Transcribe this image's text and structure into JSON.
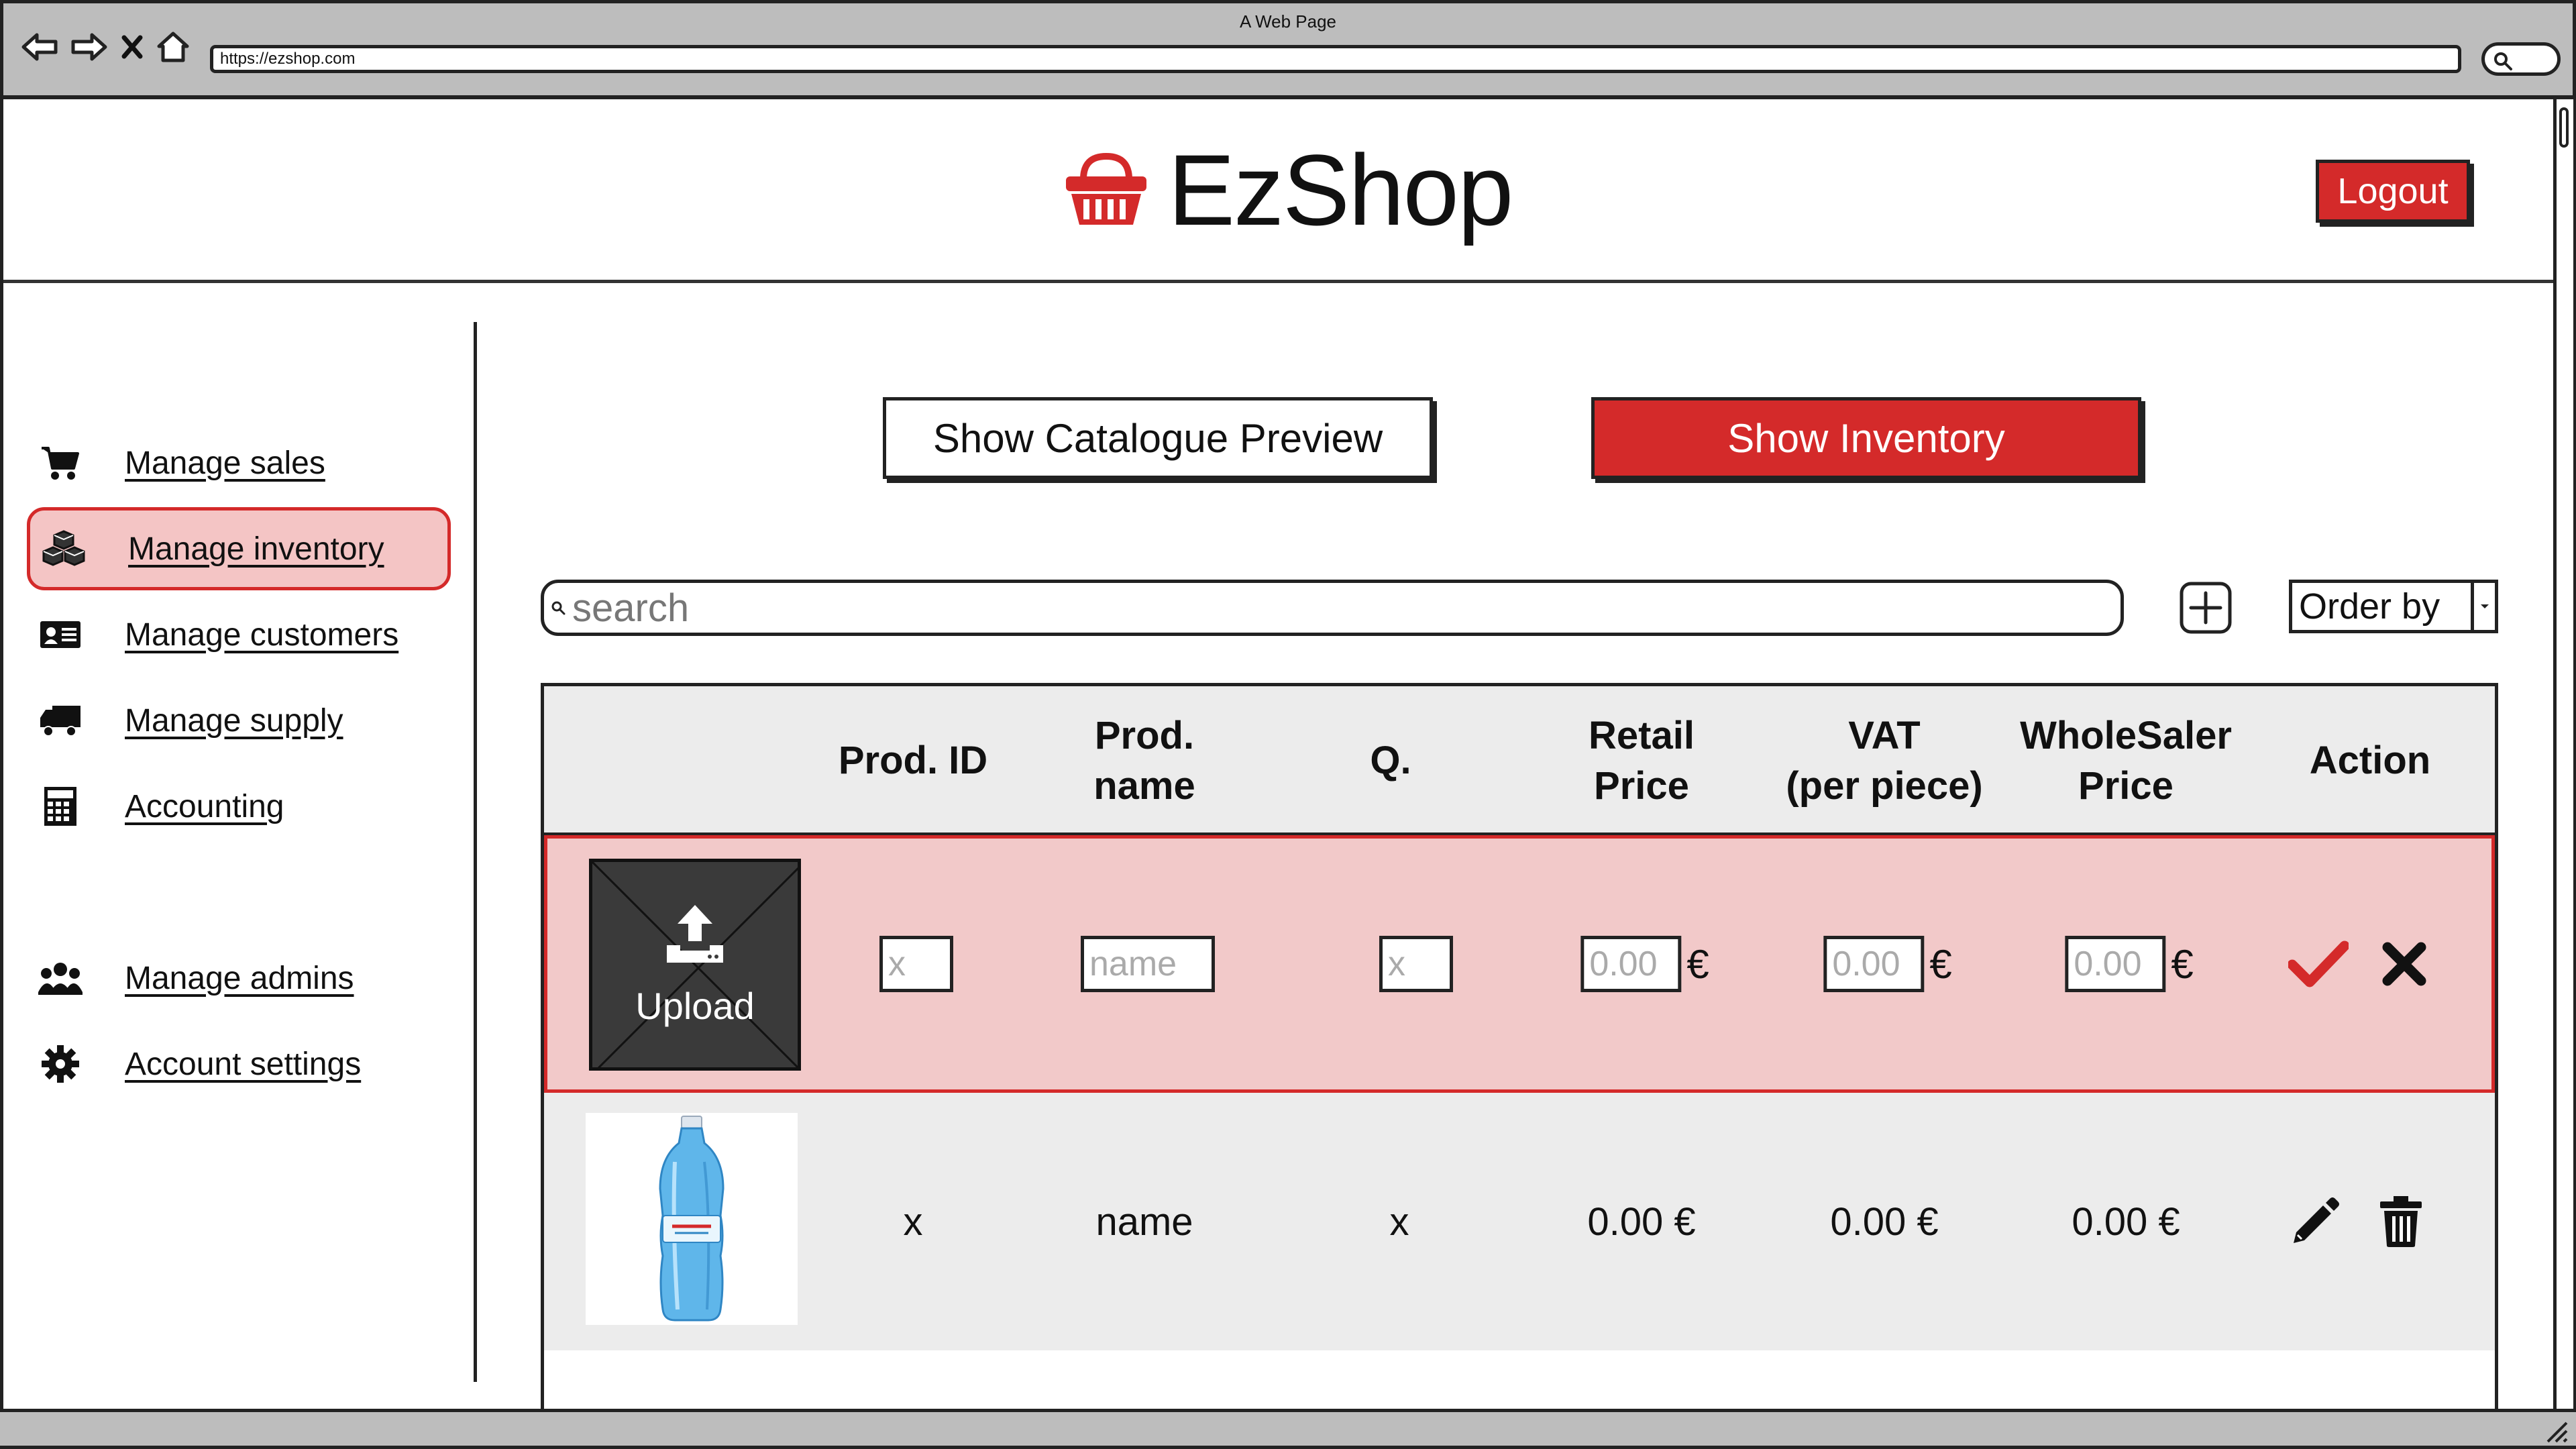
{
  "browser": {
    "title": "A Web Page",
    "url": "https://ezshop.com"
  },
  "header": {
    "brand": "EzShop",
    "logout_label": "Logout"
  },
  "sidebar": {
    "items": [
      {
        "label": "Manage sales",
        "icon": "cart-icon"
      },
      {
        "label": "Manage inventory",
        "icon": "boxes-icon",
        "active": true
      },
      {
        "label": "Manage customers",
        "icon": "id-card-icon"
      },
      {
        "label": "Manage supply",
        "icon": "truck-icon"
      },
      {
        "label": "Accounting",
        "icon": "calculator-icon"
      },
      {
        "label": "Manage admins",
        "icon": "users-icon"
      },
      {
        "label": "Account settings",
        "icon": "gear-icon"
      }
    ]
  },
  "toolbar": {
    "catalogue_label": "Show Catalogue Preview",
    "inventory_label": "Show Inventory",
    "search_placeholder": "search",
    "order_by_label": "Order by"
  },
  "table": {
    "columns": [
      "",
      "Prod. ID",
      "Prod.\nname",
      "Q.",
      "Retail\nPrice",
      "VAT\n(per piece)",
      "WholeSaler\nPrice",
      "Action"
    ],
    "new_row": {
      "upload_label": "Upload",
      "id_placeholder": "x",
      "name_placeholder": "name",
      "qty_placeholder": "x",
      "retail_placeholder": "0.00",
      "vat_placeholder": "0.00",
      "wholesale_placeholder": "0.00",
      "currency": "€"
    },
    "rows": [
      {
        "id": "x",
        "name": "name",
        "qty": "x",
        "retail": "0.00 €",
        "vat": "0.00 €",
        "wholesale": "0.00 €"
      }
    ]
  },
  "colors": {
    "accent": "#d42a2a",
    "highlight": "#f4c5c5",
    "table_header": "#ececec",
    "chrome": "#bdbdbd"
  }
}
